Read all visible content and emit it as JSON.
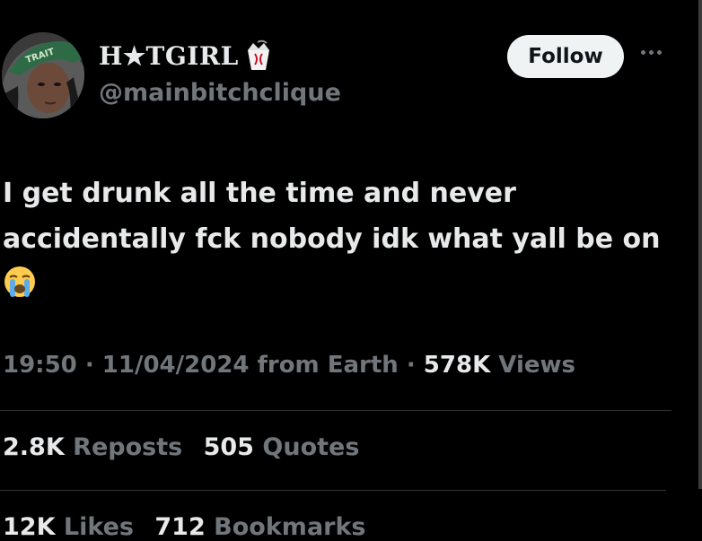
{
  "user": {
    "display_name": "H★TGIRL",
    "handle": "@mainbitchclique",
    "badge_icon": "takeout-box-emoji",
    "avatar_cap_text": "TRAIT"
  },
  "header": {
    "follow_label": "Follow",
    "more_icon": "more-dots-icon"
  },
  "tweet": {
    "text": "I get drunk all the time and never accidentally fck nobody idk what yall be on",
    "emoji": "loudly-crying-face"
  },
  "meta": {
    "time": "19:50",
    "sep1": "·",
    "date": "11/04/2024",
    "source": "from Earth",
    "sep2": "·",
    "views_count": "578K",
    "views_label": "Views"
  },
  "stats": {
    "reposts_count": "2.8K",
    "reposts_label": "Reposts",
    "quotes_count": "505",
    "quotes_label": "Quotes",
    "likes_count": "12K",
    "likes_label": "Likes",
    "bookmarks_count": "712",
    "bookmarks_label": "Bookmarks"
  },
  "colors": {
    "background": "#000000",
    "text": "#e7e9ea",
    "secondary": "#71767b",
    "divider": "#2f3336",
    "follow_bg": "#eff3f4"
  }
}
